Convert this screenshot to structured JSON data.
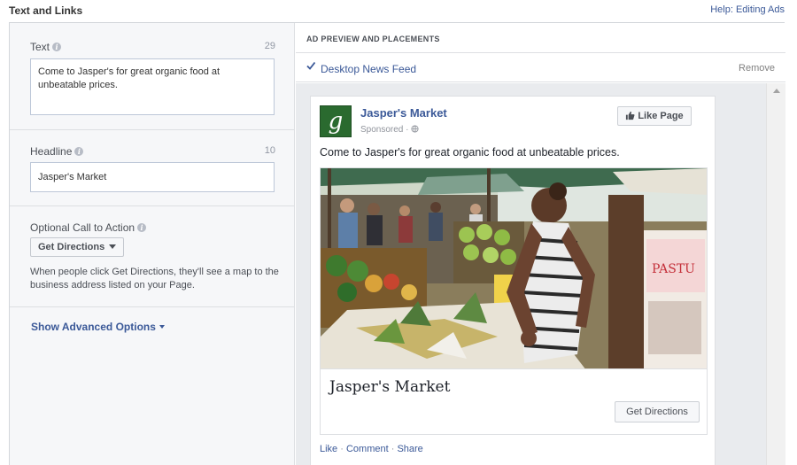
{
  "header": {
    "section_title": "Text and Links",
    "help_link": "Help: Editing Ads"
  },
  "left_panel": {
    "text_field": {
      "label": "Text",
      "remaining": "29",
      "value": "Come to Jasper's for great organic food at unbeatable prices."
    },
    "headline_field": {
      "label": "Headline",
      "remaining": "10",
      "value": "Jasper's Market"
    },
    "call_to_action": {
      "label": "Optional Call to Action",
      "selected": "Get Directions",
      "help_text": "When people click Get Directions, they'll see a map to the business address listed on your Page."
    },
    "advanced_link": "Show Advanced Options"
  },
  "right_panel": {
    "header": "AD PREVIEW AND PLACEMENTS",
    "placement": {
      "label": "Desktop News Feed",
      "remove": "Remove"
    },
    "ad": {
      "page_name": "Jasper's Market",
      "logo_letter": "g",
      "sponsored": "Sponsored",
      "like_button": "Like Page",
      "text": "Come to Jasper's for great organic food at unbeatable prices.",
      "link_title": "Jasper's Market",
      "cta_button": "Get Directions",
      "actions": {
        "like": "Like",
        "comment": "Comment",
        "share": "Share"
      }
    }
  },
  "icons": {
    "info": "info-icon",
    "check": "check-icon",
    "thumbs_up": "thumbs-up-icon",
    "globe": "globe-icon",
    "caret": "caret-down-icon"
  },
  "colors": {
    "link_blue": "#3b5998",
    "panel_bg": "#f6f7f9",
    "preview_bg": "#e9ebee",
    "logo_green": "#2a6a2f"
  }
}
